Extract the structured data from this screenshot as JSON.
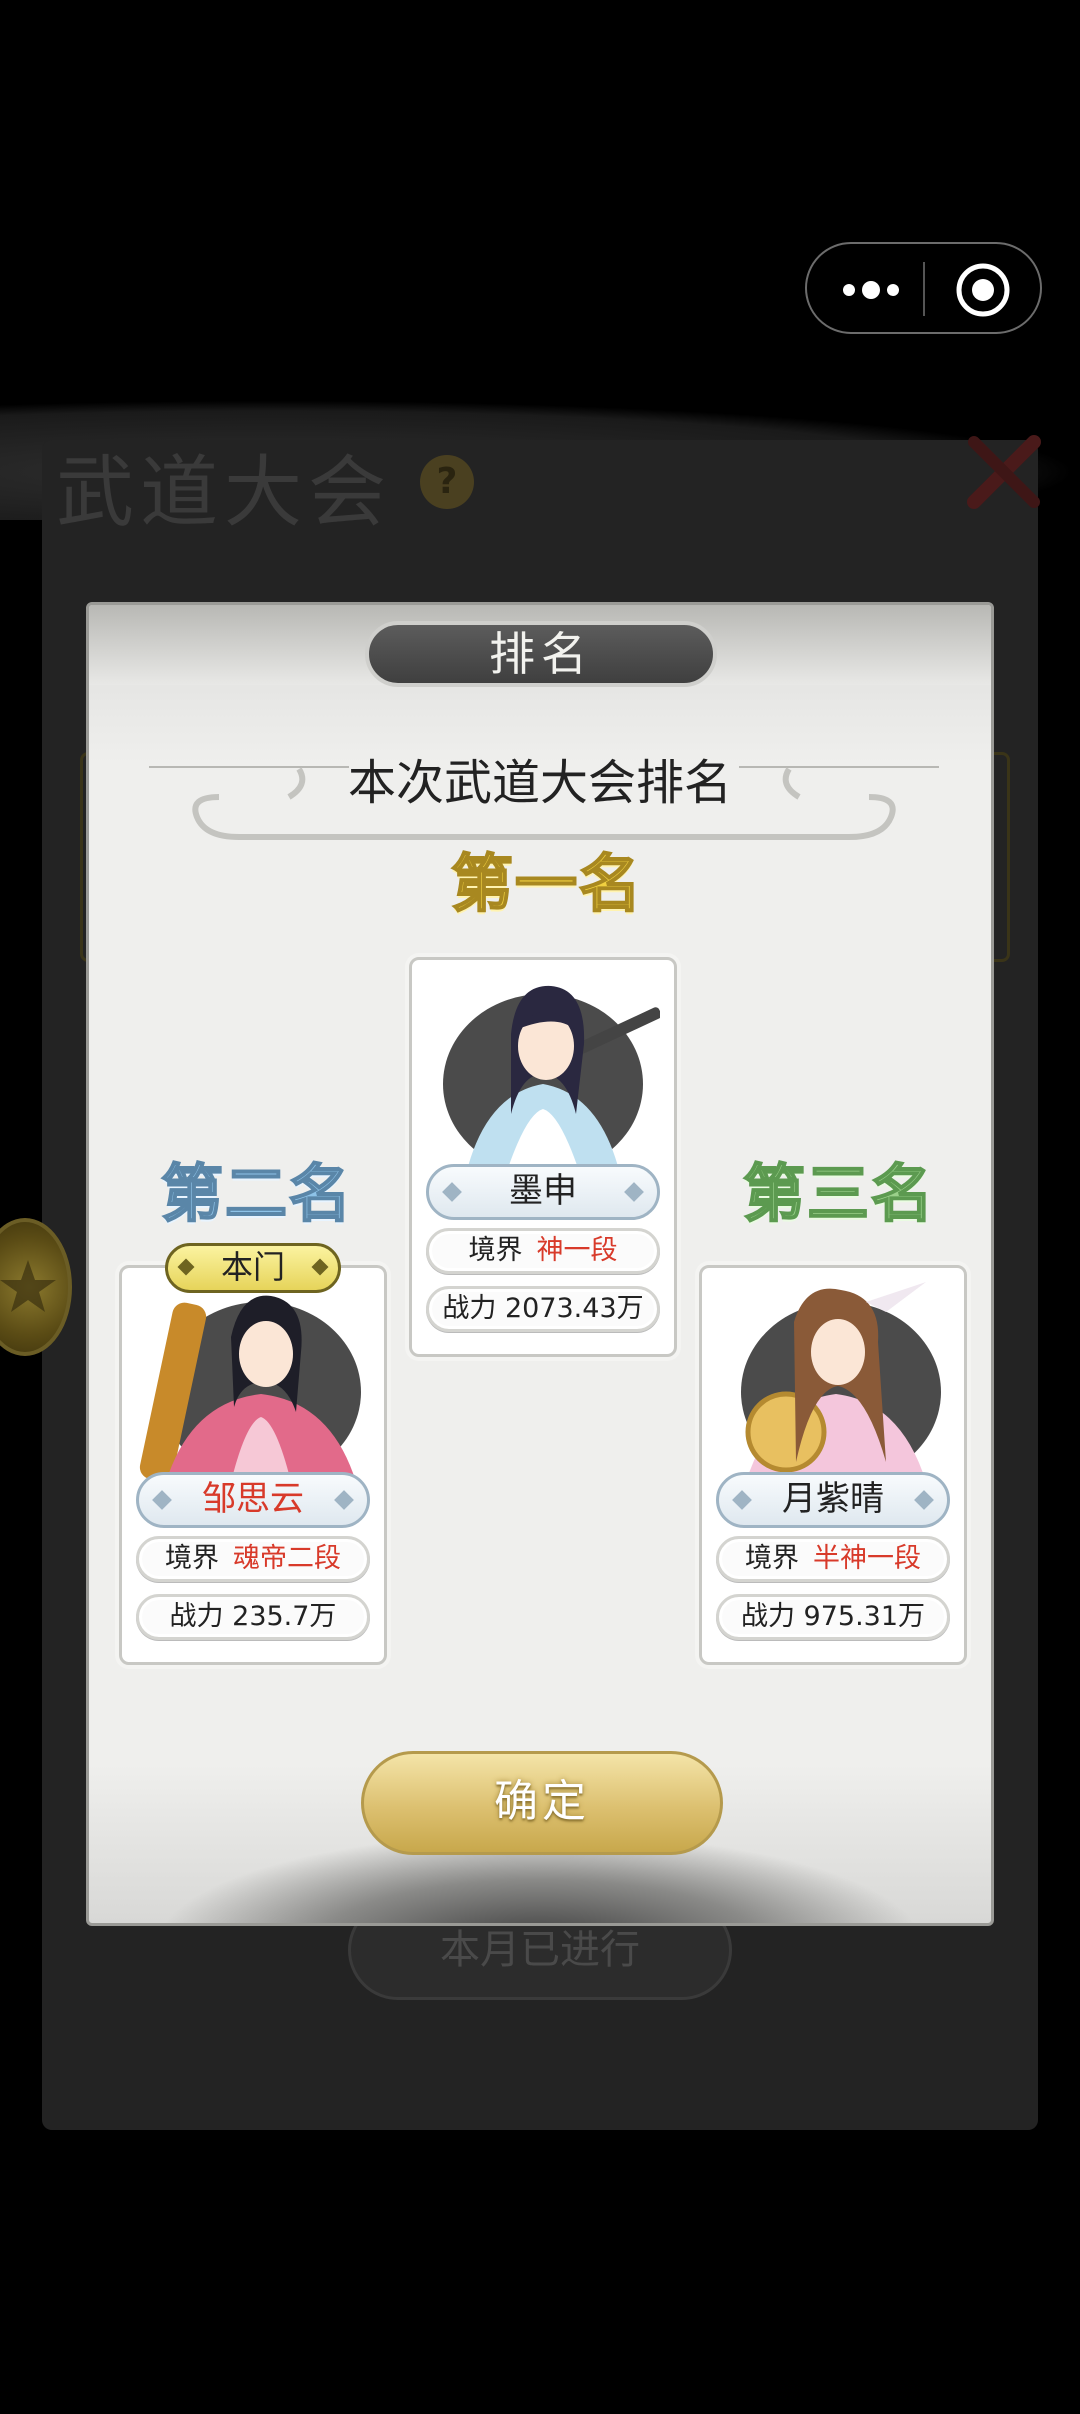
{
  "background": {
    "title": "武道大会",
    "help_icon_text": "?",
    "bottom_button": "本月已进行"
  },
  "modal": {
    "tab_title": "排名",
    "subtitle": "本次武道大会排名",
    "confirm_label": "确定"
  },
  "ranks": [
    {
      "label": "第一名",
      "name": "墨申",
      "realm_label": "境界",
      "realm_value": "神一段",
      "power_label": "战力",
      "power_value": "2073.43万",
      "label_color": "#f0d040"
    },
    {
      "label": "第二名",
      "badge": "本门",
      "name": "邹思云",
      "realm_label": "境界",
      "realm_value": "魂帝二段",
      "power_label": "战力",
      "power_value": "235.7万",
      "label_color": "#8ec3e8"
    },
    {
      "label": "第三名",
      "name": "月紫晴",
      "realm_label": "境界",
      "realm_value": "半神一段",
      "power_label": "战力",
      "power_value": "975.31万",
      "label_color": "#9ad08a"
    }
  ]
}
